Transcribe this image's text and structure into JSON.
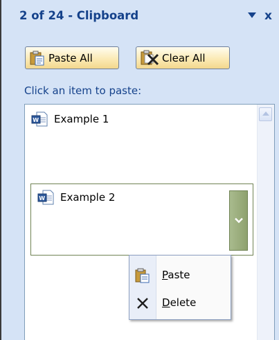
{
  "pane": {
    "title": "2 of 24 - Clipboard",
    "menu_icon": "chevron-down-icon",
    "close_label": "x"
  },
  "toolbar": {
    "paste_all_label": "Paste All",
    "clear_all_label": "Clear All"
  },
  "hint_text": "Click an item to paste:",
  "items": [
    {
      "label": "Example 1",
      "icon": "word-document-icon"
    },
    {
      "label": "Example 2",
      "icon": "word-document-icon",
      "selected": true
    }
  ],
  "context_menu": {
    "items": [
      {
        "accel": "P",
        "rest": "aste",
        "icon": "paste-icon"
      },
      {
        "accel": "D",
        "rest": "elete",
        "icon": "delete-x-icon"
      }
    ]
  },
  "colors": {
    "pane_background": "#d5e3f6",
    "title_text": "#15428b",
    "selected_border": "#6f8253",
    "item_dropdown": "#9aae7c"
  }
}
